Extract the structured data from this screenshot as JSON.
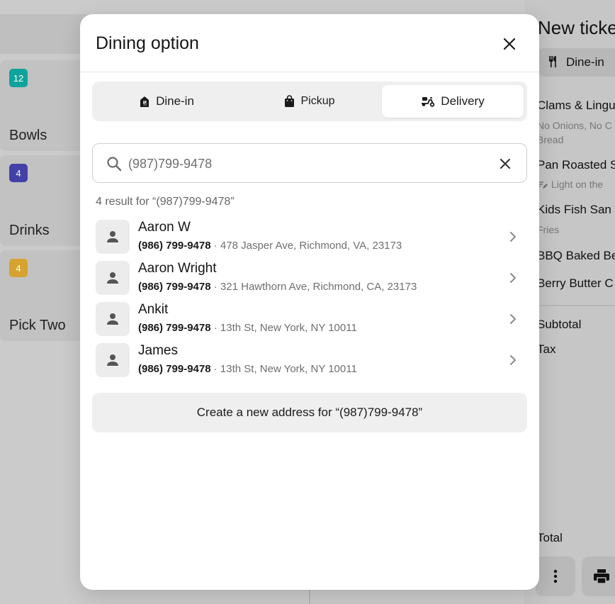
{
  "background": {
    "categories": [
      {
        "badge": "12",
        "name": "Bowls",
        "color": "#0fa39b"
      },
      {
        "badge": "4",
        "name": "Drinks",
        "color": "#4340a8"
      },
      {
        "badge": "4",
        "name": "Pick Two",
        "color": "#d6a32e"
      }
    ],
    "ticket": {
      "title": "New ticke",
      "dining_pill": "Dine-in",
      "items": [
        {
          "name": "Clams & Lingu",
          "sub": "No Onions, No C"
        },
        {
          "name": "",
          "sub": "Bread"
        },
        {
          "name": "Pan Roasted S",
          "sub": "Light on the"
        },
        {
          "name": "Kids Fish San",
          "sub": "Fries"
        },
        {
          "name": "BBQ Baked Be",
          "sub": ""
        },
        {
          "name": "Berry Butter C",
          "sub": ""
        }
      ],
      "subtotal_label": "Subtotal",
      "tax_label": "Tax",
      "total_label": "Total"
    }
  },
  "modal": {
    "title": "Dining option",
    "tabs": [
      {
        "label": "Dine-in",
        "icon": "store-icon",
        "active": false
      },
      {
        "label": "Pickup",
        "icon": "shopping-bag-icon",
        "active": false
      },
      {
        "label": "Delivery",
        "icon": "scooter-icon",
        "active": true
      }
    ],
    "search": {
      "value": "(987)799-9478",
      "placeholder": "(987)799-9478"
    },
    "result_count": "4 result for “(987)799-9478”",
    "results": [
      {
        "name": "Aaron W",
        "phone": "(986) 799-9478",
        "address": "· 478 Jasper Ave, Richmond, VA, 23173"
      },
      {
        "name": "Aaron Wright",
        "phone": "(986) 799-9478",
        "address": "· 321 Hawthorn Ave, Richmond, CA, 23173"
      },
      {
        "name": "Ankit",
        "phone": "(986) 799-9478",
        "address": "· 13th St, New York, NY 10011"
      },
      {
        "name": "James",
        "phone": "(986) 799-9478",
        "address": "· 13th St, New York, NY 10011"
      }
    ],
    "create_label": "Create a new address for “(987)799-9478”"
  }
}
